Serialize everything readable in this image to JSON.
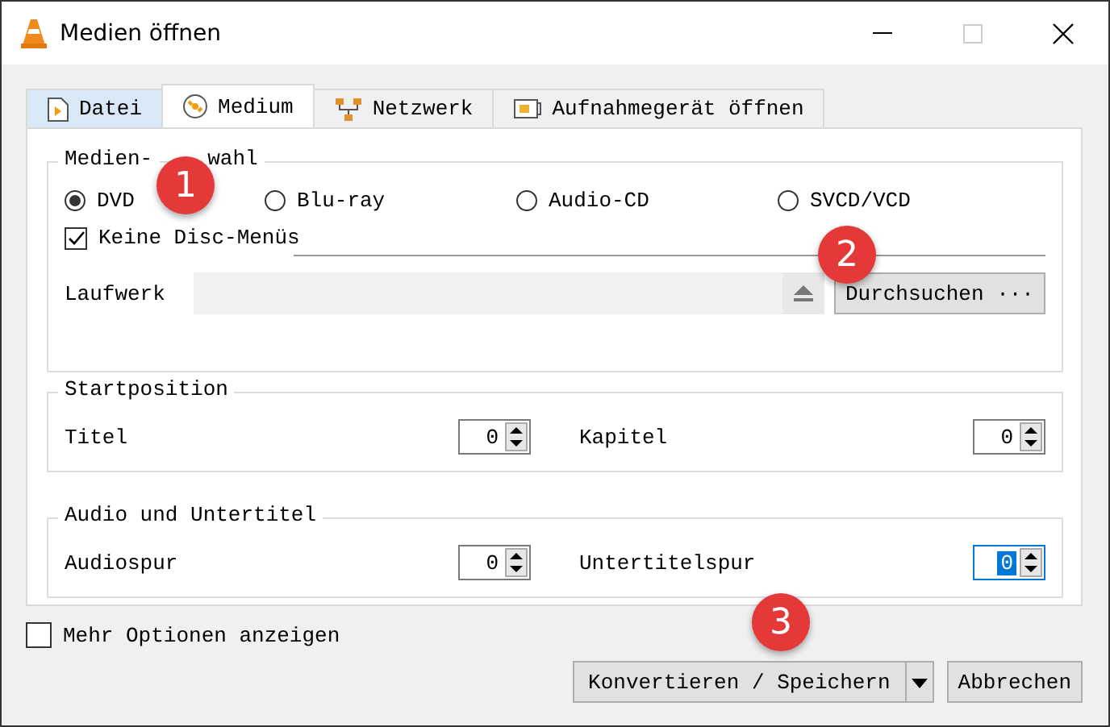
{
  "window": {
    "title": "Medien öffnen"
  },
  "tabs": [
    {
      "label": "Datei",
      "selected": false
    },
    {
      "label": "Medium",
      "selected": true
    },
    {
      "label": "Netzwerk",
      "selected": false
    },
    {
      "label": "Aufnahmegerät öffnen",
      "selected": false
    }
  ],
  "disc_selection": {
    "legend_parts": [
      "Medien-",
      "wahl"
    ],
    "options": [
      {
        "label": "DVD",
        "selected": true
      },
      {
        "label": "Blu-ray",
        "selected": false
      },
      {
        "label": "Audio-CD",
        "selected": false
      },
      {
        "label": "SVCD/VCD",
        "selected": false
      }
    ],
    "no_menus": {
      "label": "Keine Disc-Menüs",
      "checked": true
    },
    "drive_label": "Laufwerk",
    "browse_button": "Durchsuchen ···"
  },
  "start_position": {
    "legend": "Startposition",
    "fields": [
      {
        "label": "Titel",
        "value": "0",
        "focused": false
      },
      {
        "label": "Kapitel",
        "value": "0",
        "focused": false
      }
    ]
  },
  "audio_subtitles": {
    "legend": "Audio und Untertitel",
    "fields": [
      {
        "label": "Audiospur",
        "value": "0",
        "focused": false
      },
      {
        "label": "Untertitelspur",
        "value": "0",
        "focused": true
      }
    ]
  },
  "more_options": {
    "label": "Mehr Optionen anzeigen",
    "checked": false
  },
  "buttons": {
    "convert": "Konvertieren / Speichern",
    "cancel": "Abbrechen"
  },
  "callouts": [
    "1",
    "2",
    "3"
  ]
}
